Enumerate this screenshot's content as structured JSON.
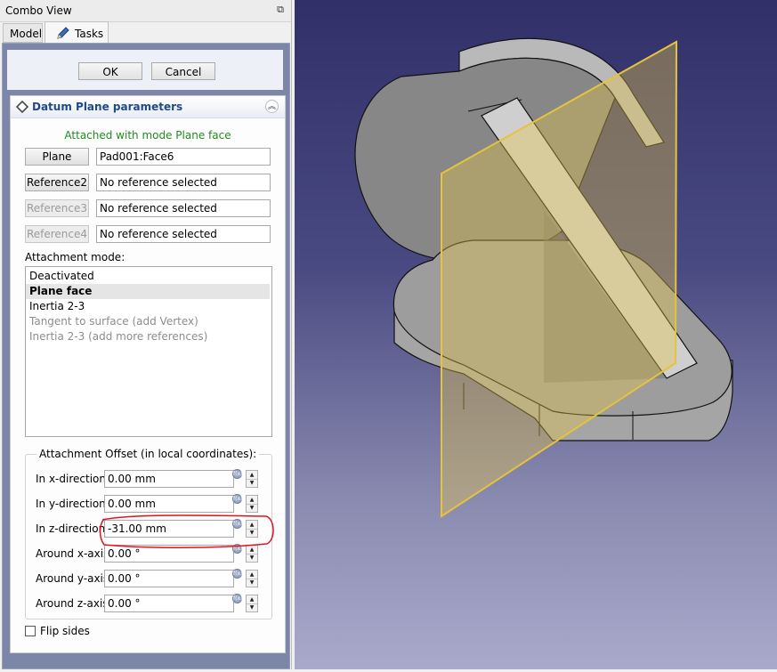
{
  "window": {
    "title": "Combo View",
    "float_icon": "float-window-icon"
  },
  "tabs": [
    {
      "label": "Model"
    },
    {
      "label": "Tasks",
      "icon": "pencil-icon"
    }
  ],
  "buttons": {
    "ok": "OK",
    "cancel": "Cancel"
  },
  "datum": {
    "title": "Datum Plane parameters",
    "status": "Attached with mode Plane face",
    "references": [
      {
        "button": "Plane",
        "value": "Pad001:Face6",
        "enabled": true
      },
      {
        "button": "Reference2",
        "value": "No reference selected",
        "enabled": true
      },
      {
        "button": "Reference3",
        "value": "No reference selected",
        "enabled": false
      },
      {
        "button": "Reference4",
        "value": "No reference selected",
        "enabled": false
      }
    ],
    "attachment_mode_label": "Attachment mode:",
    "modes": [
      {
        "label": "Deactivated",
        "state": "normal"
      },
      {
        "label": "Plane face",
        "state": "selected"
      },
      {
        "label": "Inertia 2-3",
        "state": "normal"
      },
      {
        "label": "Tangent to surface (add Vertex)",
        "state": "disabled"
      },
      {
        "label": "Inertia 2-3 (add more references)",
        "state": "disabled"
      }
    ],
    "offset": {
      "title": "Attachment Offset (in local coordinates):",
      "rows": [
        {
          "label": "In x-direction:",
          "value": "0.00 mm"
        },
        {
          "label": "In y-direction:",
          "value": "0.00 mm"
        },
        {
          "label": "In z-direction:",
          "value": "-31.00 mm"
        },
        {
          "label": "Around x-axis:",
          "value": "0.00 °"
        },
        {
          "label": "Around y-axis:",
          "value": "0.00 °"
        },
        {
          "label": "Around z-axis:",
          "value": "0.00 °"
        }
      ]
    },
    "flip_sides": {
      "label": "Flip sides",
      "checked": false
    }
  },
  "colors": {
    "status_green": "#1f8c1f",
    "annotation_red": "#e0141e",
    "datum_plane": "#e8c84a",
    "viewport_top": "#313069",
    "viewport_bottom": "#a9aacb"
  }
}
